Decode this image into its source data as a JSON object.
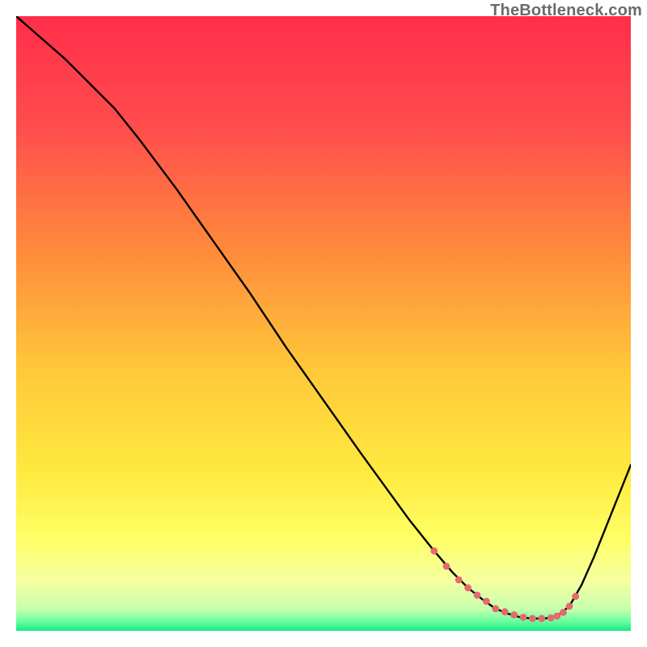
{
  "watermark": "TheBottleneck.com",
  "chart_data": {
    "type": "line",
    "title": "",
    "xlabel": "",
    "ylabel": "",
    "xlim": [
      0,
      100
    ],
    "ylim": [
      0,
      100
    ],
    "grid": false,
    "legend": false,
    "background": {
      "type": "vertical-gradient",
      "stops": [
        {
          "pos": 0.0,
          "color": "#ff2e4a"
        },
        {
          "pos": 0.18,
          "color": "#ff4d4d"
        },
        {
          "pos": 0.38,
          "color": "#ff8a3b"
        },
        {
          "pos": 0.58,
          "color": "#ffc93a"
        },
        {
          "pos": 0.74,
          "color": "#ffe93e"
        },
        {
          "pos": 0.85,
          "color": "#ffff66"
        },
        {
          "pos": 0.92,
          "color": "#f4ffa1"
        },
        {
          "pos": 0.965,
          "color": "#c7ffad"
        },
        {
          "pos": 0.985,
          "color": "#66ff9e"
        },
        {
          "pos": 1.0,
          "color": "#18e888"
        }
      ]
    },
    "series": [
      {
        "name": "bottleneck-curve",
        "x": [
          0,
          4,
          8,
          12,
          16,
          20,
          26,
          32,
          38,
          44,
          50,
          56,
          60,
          64,
          68,
          71,
          73.5,
          76,
          78,
          80,
          82,
          84,
          86,
          88,
          90,
          92,
          94,
          96,
          98,
          100
        ],
        "y": [
          100,
          96.5,
          93,
          89,
          85,
          80,
          72,
          63.5,
          55,
          46,
          37.5,
          29,
          23.5,
          18,
          13,
          9.5,
          7,
          5,
          3.6,
          2.8,
          2.2,
          2.0,
          2.0,
          2.4,
          4.0,
          7.5,
          12,
          17,
          22,
          27
        ]
      }
    ],
    "highlight": {
      "name": "optimal-range-markers",
      "color": "#e56a6f",
      "radius": 4.4,
      "x": [
        68,
        70,
        72,
        73.5,
        75,
        76.5,
        78,
        79.5,
        81,
        82.5,
        84,
        85.5,
        87,
        88,
        89,
        90,
        91
      ],
      "y": [
        13,
        10.5,
        8.3,
        7,
        5.8,
        4.8,
        3.6,
        3.1,
        2.6,
        2.2,
        2.0,
        2.0,
        2.1,
        2.4,
        3.0,
        4.0,
        5.6
      ]
    }
  }
}
